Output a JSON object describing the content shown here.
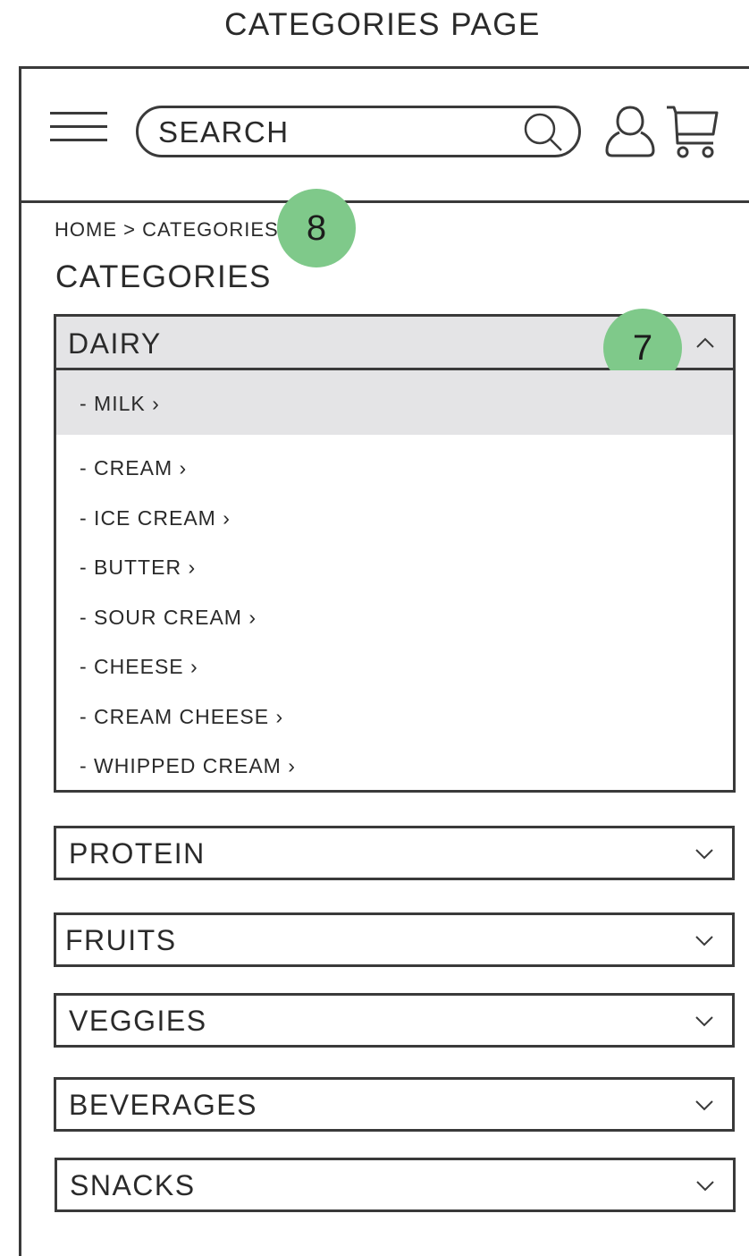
{
  "page_caption": "CATEGORIES PAGE",
  "header": {
    "search_placeholder": "SEARCH"
  },
  "breadcrumb": {
    "home": "HOME",
    "separator": ">",
    "current": "CATEGORIES"
  },
  "title": "CATEGORIES",
  "annotations": {
    "breadcrumb_marker": "8",
    "accordion_marker": "7"
  },
  "colors": {
    "annotation": "#7fc98a",
    "highlight": "#e4e4e6",
    "stroke": "#3a3a3a"
  },
  "expanded_category": {
    "label": "DAIRY",
    "items": [
      "- MILK ›",
      "- CREAM ›",
      "- ICE CREAM ›",
      "- BUTTER ›",
      "- SOUR CREAM ›",
      "- CHEESE ›",
      "- CREAM CHEESE ›",
      "- WHIPPED CREAM ›"
    ]
  },
  "collapsed_categories": [
    {
      "label": "PROTEIN"
    },
    {
      "label": "FRUITS"
    },
    {
      "label": "VEGGIES"
    },
    {
      "label": "BEVERAGES"
    },
    {
      "label": "SNACKS"
    }
  ]
}
